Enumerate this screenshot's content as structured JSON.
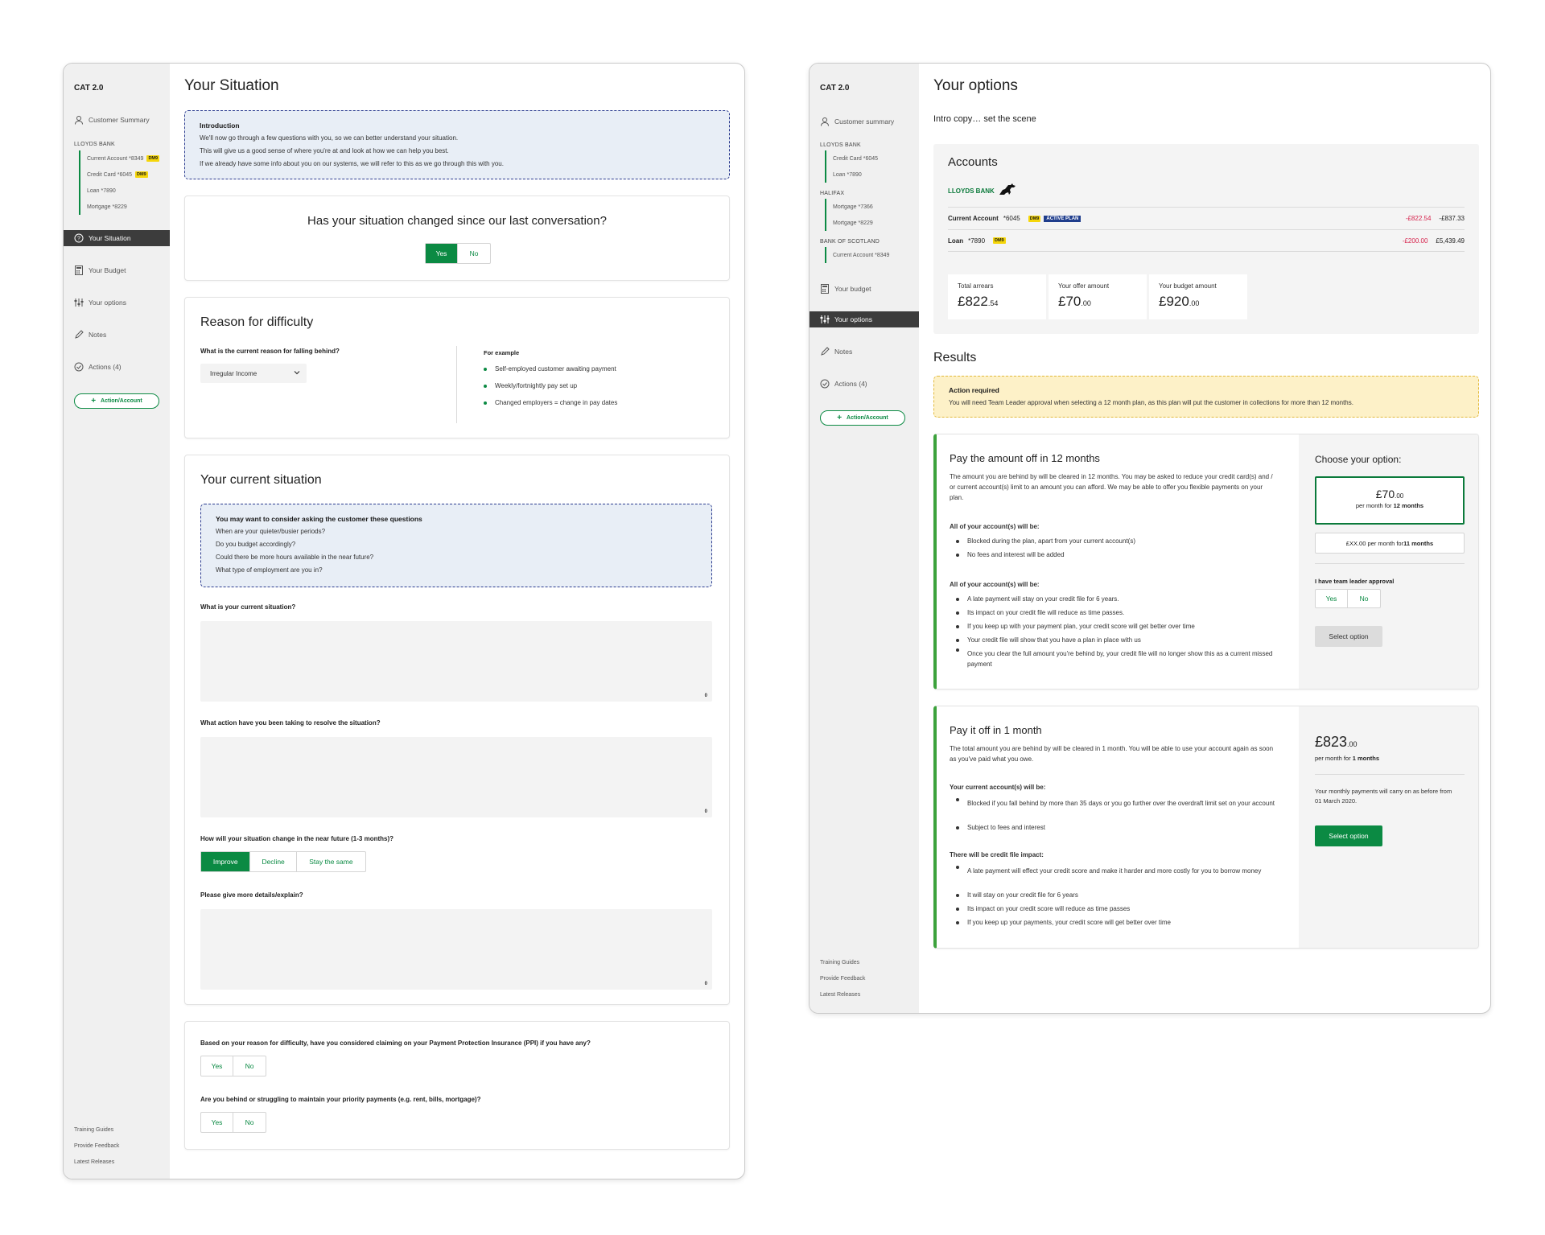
{
  "left": {
    "brand": "CAT 2.0",
    "sidebar": {
      "customer_summary": "Customer Summary",
      "bank": "LLOYDS BANK",
      "accounts": [
        {
          "label": "Current Account *8349",
          "badge": "DM9"
        },
        {
          "label": "Credit Card *6045",
          "badge": "DM9"
        },
        {
          "label": "Loan *7890",
          "badge": ""
        },
        {
          "label": "Mortgage *8229",
          "badge": ""
        }
      ],
      "nav": [
        "Your Situation",
        "Your Budget",
        "Your options",
        "Notes",
        "Actions (4)"
      ],
      "action_button": "Action/Account",
      "footer": [
        "Training Guides",
        "Provide Feedback",
        "Latest Releases"
      ]
    },
    "title": "Your Situation",
    "intro": {
      "heading": "Introduction",
      "lines": [
        "We'll now go through a few questions with you, so we can better understand your situation.",
        "This will give us a good sense of where you're at and look at how we can help you best.",
        "If we already have some info about you on our systems, we will refer to this as we go through this with you."
      ]
    },
    "changed": {
      "question": "Has your situation changed since our last conversation?",
      "yes": "Yes",
      "no": "No",
      "selected": "Yes"
    },
    "reason": {
      "title": "Reason for difficulty",
      "question": "What is the current reason for falling behind?",
      "select_value": "Irregular Income",
      "example_title": "For example",
      "examples": [
        "Self-employed customer awaiting payment",
        "Weekly/fortnightly pay set up",
        "Changed employers = change in pay dates"
      ]
    },
    "current": {
      "title": "Your current situation",
      "tip_heading": "You may want to consider asking the customer these questions",
      "tip_lines": [
        "When are your quieter/busier periods?",
        "Do you budget accordingly?",
        "Could there be more hours available in the near future?",
        "What type of employment are you in?"
      ],
      "q1": "What is your current situation?",
      "q2": "What action have you been taking to resolve the situation?",
      "q3": "How will your situation change in the near future (1-3 months)?",
      "q3_options": [
        "Improve",
        "Decline",
        "Stay the same"
      ],
      "q3_selected": "Improve",
      "q4": "Please give more details/explain?",
      "count": "0"
    },
    "ppi": {
      "q1": "Based on your reason for difficulty, have you considered claiming on your Payment Protection Insurance (PPI) if you have any?",
      "q2": "Are you behind or struggling to maintain your priority payments (e.g. rent, bills, mortgage)?",
      "yes": "Yes",
      "no": "No"
    }
  },
  "right": {
    "brand": "CAT 2.0",
    "sidebar": {
      "customer_summary": "Customer summary",
      "banks": [
        {
          "name": "LLOYDS BANK",
          "accounts": [
            "Credit Card *6045",
            "Loan *7890"
          ]
        },
        {
          "name": "HALIFAX",
          "accounts": [
            "Mortgage *7366",
            "Mortgage *8229"
          ]
        },
        {
          "name": "BANK OF SCOTLAND",
          "accounts": [
            "Current Account *8349"
          ]
        }
      ],
      "nav": [
        "Your budget",
        "Your options",
        "Notes",
        "Actions (4)"
      ],
      "action_button": "Action/Account",
      "footer": [
        "Training Guides",
        "Provide Feedback",
        "Latest Releases"
      ]
    },
    "title": "Your options",
    "intro": "Intro copy… set the scene",
    "accounts": {
      "title": "Accounts",
      "bank": "LLOYDS BANK",
      "rows": [
        {
          "name": "Current Account",
          "num": "*6045",
          "badge": "DM9",
          "plan": "ACTIVE PLAN",
          "arrears": "-£822.54",
          "balance": "-£837.33"
        },
        {
          "name": "Loan",
          "num": "*7890",
          "badge": "DM9",
          "plan": "",
          "arrears": "-£200.00",
          "balance": "£5,439.49"
        }
      ],
      "totals": [
        {
          "label": "Total arrears",
          "main": "£822",
          "dec": ".54",
          "red": true
        },
        {
          "label": "Your offer amount",
          "main": "£70",
          "dec": ".00",
          "red": false
        },
        {
          "label": "Your budget amount",
          "main": "£920",
          "dec": ".00",
          "red": false
        }
      ]
    },
    "results": {
      "title": "Results",
      "alert_heading": "Action required",
      "alert_text": "You will need Team Leader approval when selecting a 12 month plan, as this plan will put the customer in collections for more than 12 months."
    },
    "option1": {
      "title": "Pay the amount off in 12 months",
      "desc": "The amount you are behind by will be cleared in 12 months. You may be asked to reduce your credit card(s) and / or current account(s) limit to an amount you can afford. We may be able to offer you flexible payments on your plan.",
      "sub1": "All of your account(s) will be:",
      "list1": [
        "Blocked during the plan, apart from your current account(s)",
        "No fees and interest will be added"
      ],
      "sub2": "All of your account(s) will be:",
      "list2": [
        "A late payment will stay on your credit file for 6 years.",
        "Its impact on your credit file will reduce as time passes.",
        "If you keep up with your payment plan, your credit score will get better over time",
        "Your credit file will show that you have a plan in place with us",
        "Once you clear the full amount you're behind by, your credit file will no longer show this as a current missed payment"
      ],
      "choose": "Choose your option:",
      "opt_a_main": "£70",
      "opt_a_dec": ".00",
      "opt_a_sub": "per month for ",
      "opt_a_bold": "12 months",
      "opt_b": "£XX.00 per month for ",
      "opt_b_bold": "11 months",
      "approval": "I have team leader approval",
      "yes": "Yes",
      "no": "No",
      "select": "Select option"
    },
    "option2": {
      "title": "Pay it off in 1 month",
      "desc": "The total amount you are behind by will be cleared in 1 month. You will be able to use your account again as soon as you've paid what you owe.",
      "sub1": "Your current account(s) will be:",
      "list1": [
        "Blocked if you fall behind by more than 35 days or you go further over the overdraft limit set on your account",
        "Subject to fees and interest"
      ],
      "sub2": "There will be credit file impact:",
      "list2": [
        "A late payment will effect your credit score and make it harder and more costly for you to borrow money",
        "It will stay on your credit file for 6 years",
        "Its impact on your credit score will reduce as time passes",
        "If you keep up your payments, your credit score will get better over time"
      ],
      "amount_main": "£823",
      "amount_dec": ".00",
      "per_month": "per month for ",
      "per_bold": "1 months",
      "note": "Your monthly payments will carry on as before from 01 March 2020.",
      "select": "Select option"
    }
  }
}
